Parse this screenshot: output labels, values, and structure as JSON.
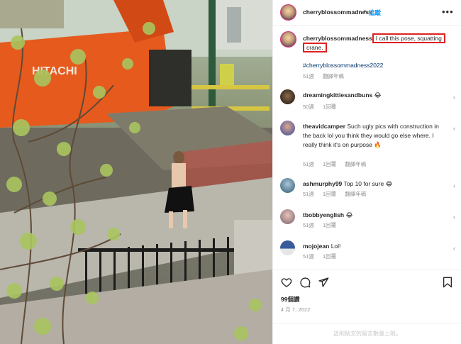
{
  "post": {
    "username": "cherryblossommadness",
    "separator": "•",
    "follow_label": "追蹤",
    "more_label": "•••",
    "caption_username": "cherryblossommadness",
    "caption_text_line1": "I call this pose, squatting",
    "caption_text_line2": "crane.",
    "hashtag": "#cherryblossommadness2022",
    "caption_age": "51週",
    "caption_translate": "翻譯年稿"
  },
  "comments": [
    {
      "username": "dreamingkittiesandbuns",
      "text": "😂",
      "age": "50週",
      "reply": "1回覆",
      "translate": ""
    },
    {
      "username": "theavidcamper",
      "text": "Such ugly pics with construction in the back lol you think they would go else where. I really think it's on purpose 🔥",
      "age": "51週",
      "reply": "1回覆",
      "translate": "翻譯年稿"
    },
    {
      "username": "ashmurphy99",
      "text": "Top 10 for sure 😂",
      "age": "51週",
      "reply": "1回覆",
      "translate": "翻譯年稿"
    },
    {
      "username": "tbobbyenglish",
      "text": "😂",
      "age": "51週",
      "reply": "1回覆",
      "translate": ""
    },
    {
      "username": "mojojean",
      "text": "Lol!",
      "age": "51週",
      "reply": "1回覆",
      "translate": ""
    }
  ],
  "actions": {
    "like_icon": "heart-icon",
    "comment_icon": "comment-icon",
    "share_icon": "send-icon",
    "save_icon": "bookmark-icon"
  },
  "likes_label": "99個讚",
  "date": "4 月 7, 2022",
  "limited_note": "這則貼文的留言數量上限。",
  "photo": {
    "description_icon": "photo",
    "sign_text": "HITACHI"
  },
  "colors": {
    "highlight_box": "#e02020",
    "link_blue": "#0095f6",
    "hashtag": "#00376b",
    "muted": "#8e8e8e"
  }
}
